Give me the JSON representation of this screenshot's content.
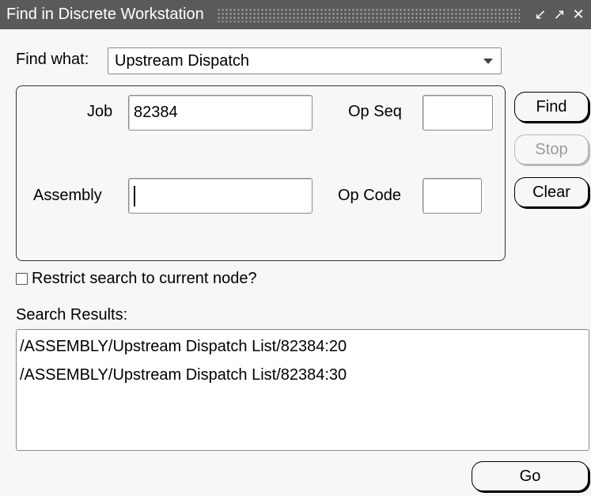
{
  "window": {
    "title": "Find in Discrete Workstation",
    "controls": [
      "↙",
      "↗",
      "✕"
    ]
  },
  "find_what": {
    "label": "Find what:",
    "selected": "Upstream Dispatch"
  },
  "criteria": {
    "job_label": "Job",
    "job_value": "82384",
    "op_seq_label": "Op Seq",
    "op_seq_value": "",
    "assembly_label": "Assembly",
    "assembly_value": "",
    "op_code_label": "Op Code",
    "op_code_value": ""
  },
  "buttons": {
    "find": "Find",
    "stop": "Stop",
    "clear": "Clear",
    "go": "Go"
  },
  "restrict": {
    "label": "Restrict search to current node?",
    "checked": false
  },
  "results": {
    "label": "Search Results:",
    "items": [
      "/ASSEMBLY/Upstream Dispatch List/82384:20",
      "/ASSEMBLY/Upstream Dispatch List/82384:30"
    ]
  }
}
